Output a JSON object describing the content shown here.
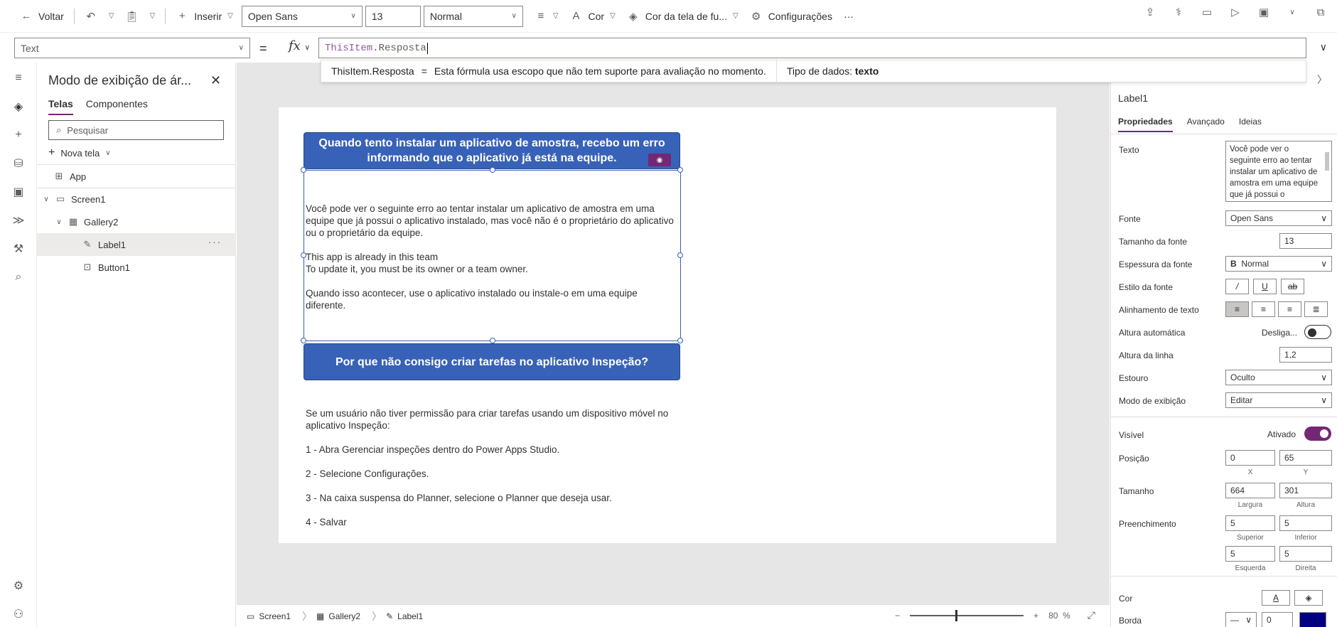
{
  "toolbar": {
    "back": "Voltar",
    "insert": "Inserir",
    "font": "Open Sans",
    "font_size": "13",
    "font_weight": "Normal",
    "color": "Cor",
    "fill": "Cor da tela de fu...",
    "settings": "Configurações",
    "more": "···"
  },
  "formula": {
    "property": "Text",
    "equals": "=",
    "fx": "fx",
    "keyword": "ThisItem",
    "dot": ".",
    "field": "Resposta",
    "hint_expr": "ThisItem.Resposta",
    "hint_eq": "=",
    "hint_msg": "Esta fórmula usa escopo que não tem suporte para avaliação no momento.",
    "hint_type_label": "Tipo de dados:",
    "hint_type_value": "texto"
  },
  "tree": {
    "title": "Modo de exibição de ár...",
    "tabs": [
      "Telas",
      "Componentes"
    ],
    "search_placeholder": "Pesquisar",
    "new_screen": "Nova tela",
    "nodes": [
      "App",
      "Screen1",
      "Gallery2",
      "Label1",
      "Button1"
    ]
  },
  "canvas": {
    "q1": "Quando tento instalar um aplicativo de amostra, recebo um erro informando que o aplicativo já está na equipe.",
    "a1": "Você pode ver o seguinte erro ao tentar instalar um aplicativo de amostra em uma equipe que já possui o aplicativo instalado, mas você não é o proprietário do aplicativo ou o proprietário da equipe.\n\nThis app is already in this team\nTo update it, you must be its owner or a team owner.\n\nQuando isso acontecer, use o aplicativo instalado ou instale-o em uma equipe diferente.",
    "q2": "Por que não consigo criar tarefas no aplicativo Inspeção?",
    "a2": "Se um usuário não tiver permissão para criar tarefas usando um dispositivo móvel no aplicativo Inspeção:\n\n1 - Abra Gerenciar inspeções dentro do Power Apps Studio.\n\n2 - Selecione Configurações.\n\n3 - Na caixa suspensa do Planner, selecione o Planner que deseja usar.\n\n4 - Salvar"
  },
  "statusbar": {
    "crumbs": [
      "Screen1",
      "Gallery2",
      "Label1"
    ],
    "zoom": "80",
    "zoom_unit": "%"
  },
  "props": {
    "control": "Label1",
    "tabs": [
      "Propriedades",
      "Avançado",
      "Ideias"
    ],
    "text_label": "Texto",
    "text_value": "Você pode ver o seguinte erro ao tentar instalar um aplicativo de amostra em uma equipe que já possui o aplicativo instalado",
    "font_label": "Fonte",
    "font_value": "Open Sans",
    "size_label": "Tamanho da fonte",
    "size_value": "13",
    "weight_label": "Espessura da fonte",
    "weight_icon": "B",
    "weight_value": "Normal",
    "style_label": "Estilo da fonte",
    "align_label": "Alinhamento de texto",
    "autoheight_label": "Altura automática",
    "autoheight_value": "Desliga...",
    "lineheight_label": "Altura da linha",
    "lineheight_value": "1,2",
    "overflow_label": "Estouro",
    "overflow_value": "Oculto",
    "display_label": "Modo de exibição",
    "display_value": "Editar",
    "visible_label": "Visível",
    "visible_value": "Ativado",
    "position_label": "Posição",
    "pos_x": "0",
    "pos_y": "65",
    "cap_x": "X",
    "cap_y": "Y",
    "size2_label": "Tamanho",
    "width": "664",
    "height": "301",
    "cap_w": "Largura",
    "cap_h": "Altura",
    "padding_label": "Preenchimento",
    "pad_top": "5",
    "pad_bottom": "5",
    "cap_top": "Superior",
    "cap_bottom": "Inferior",
    "pad_left": "5",
    "pad_right": "5",
    "cap_left": "Esquerda",
    "cap_right": "Direita",
    "color_label": "Cor",
    "border_label": "Borda",
    "border_value": "0",
    "border_color": "#000080"
  },
  "colors": {
    "accent": "#742774",
    "bar": "#3862b8"
  }
}
